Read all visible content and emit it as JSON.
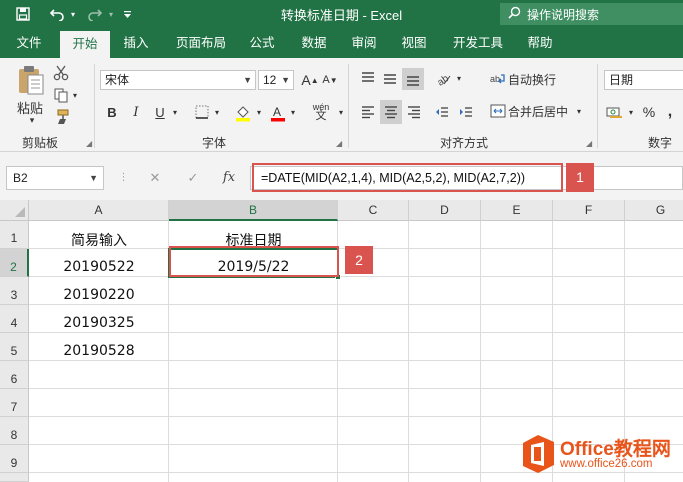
{
  "window": {
    "title": "转换标准日期  -  Excel",
    "search_placeholder": "操作说明搜索",
    "qat": [
      "save-icon",
      "undo-icon",
      "redo-icon",
      "customize-icon"
    ]
  },
  "tabs": [
    "文件",
    "开始",
    "插入",
    "页面布局",
    "公式",
    "数据",
    "审阅",
    "视图",
    "开发工具",
    "帮助"
  ],
  "active_tab": "开始",
  "ribbon": {
    "clipboard": {
      "paste_label": "粘贴",
      "group_label": "剪贴板"
    },
    "font": {
      "name": "宋体",
      "size": "12",
      "grow": "A",
      "shrink": "A",
      "bold": "B",
      "italic": "I",
      "underline": "U",
      "phonetic": "wén",
      "group_label": "字体"
    },
    "alignment": {
      "wrap_text": "自动换行",
      "merge_center": "合并后居中",
      "group_label": "对齐方式"
    },
    "number": {
      "format": "日期",
      "percent": "%",
      "comma": ",",
      "group_label": "数字"
    }
  },
  "formula_bar": {
    "name_box": "B2",
    "cancel": "✕",
    "enter": "✓",
    "fx": "fx",
    "formula": "=DATE(MID(A2,1,4), MID(A2,5,2), MID(A2,7,2))"
  },
  "annotations": {
    "label1": "1",
    "label2": "2"
  },
  "sheet": {
    "columns": [
      "A",
      "B",
      "C",
      "D",
      "E",
      "F",
      "G"
    ],
    "rows": [
      "1",
      "2",
      "3",
      "4",
      "5",
      "6",
      "7",
      "8",
      "9"
    ],
    "cells": {
      "A1": "简易输入",
      "B1": "标准日期",
      "A2": "20190522",
      "B2": "2019/5/22",
      "A3": "20190220",
      "A4": "20190325",
      "A5": "20190528"
    },
    "active_cell": "B2"
  },
  "watermark": {
    "brand": "Office教程网",
    "url": "www.office26.com"
  },
  "colors": {
    "accent": "#217346",
    "highlight": "#d9534f",
    "watermark": "#e8541a"
  }
}
